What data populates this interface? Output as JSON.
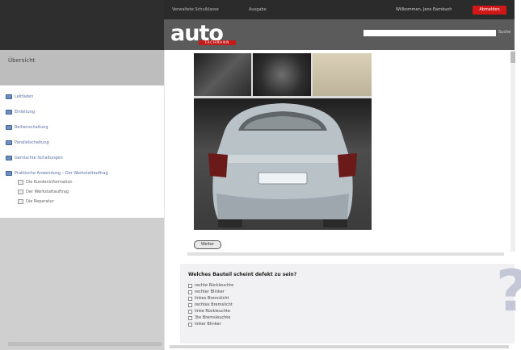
{
  "header": {
    "nav": [
      "Verwaltete Schulklasse",
      "Ausgabe"
    ],
    "welcome": "Willkommen, Jens Earnbuch",
    "logout": "Abmelden",
    "logo": "auto",
    "logo_sub": "FACHMANN",
    "search_placeholder": "",
    "search_go": "Suche"
  },
  "sidebar": {
    "title": "Übersicht",
    "items": [
      {
        "label": "Leitfaden"
      },
      {
        "label": "Einleitung"
      },
      {
        "label": "Reihenschaltung"
      },
      {
        "label": "Parallelschaltung"
      },
      {
        "label": "Gemischte Schaltungen"
      },
      {
        "label": "Praktische Anwendung – Der Werkstattauftrag"
      }
    ],
    "subitems": [
      {
        "label": "Die Kundeninformation"
      },
      {
        "label": "Der Werkstattauftrag"
      },
      {
        "label": "Die Reparatur"
      }
    ]
  },
  "main": {
    "next_button": "Weiter",
    "question": "Welches Bauteil scheint defekt zu sein?",
    "options": [
      "rechte Rückleuchte",
      "rechter Blinker",
      "linkes Bremslicht",
      "rechtes Bremslicht",
      "linke Rückleuchte",
      "3te Bremsleuchte",
      "linker Blinker"
    ]
  }
}
